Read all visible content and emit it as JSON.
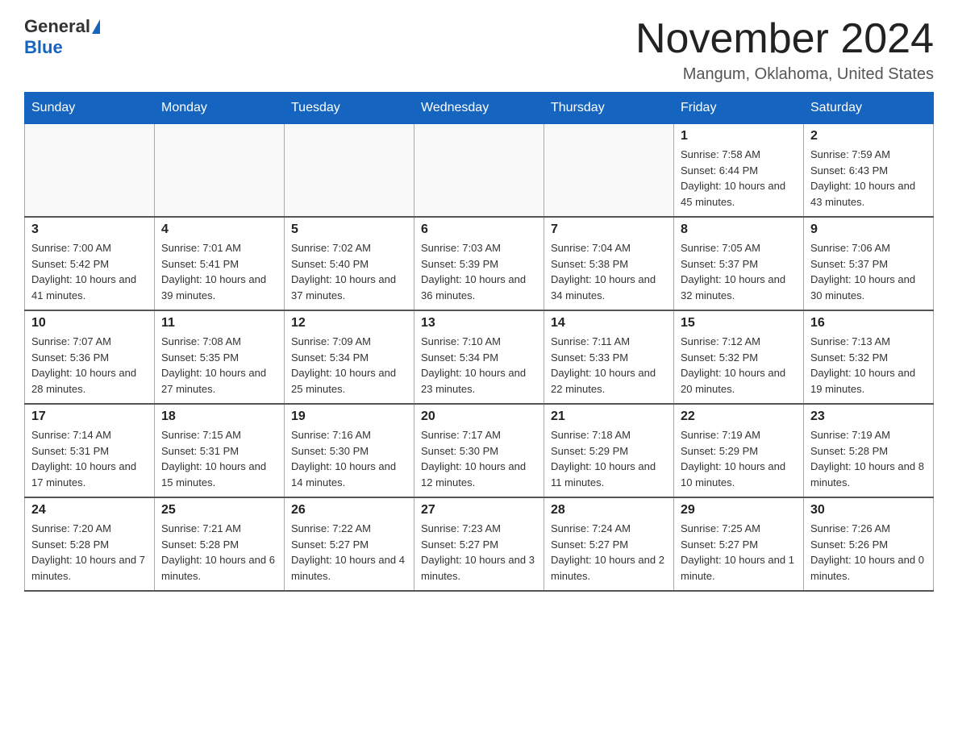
{
  "header": {
    "logo_general": "General",
    "logo_blue": "Blue",
    "month_title": "November 2024",
    "location": "Mangum, Oklahoma, United States"
  },
  "days_of_week": [
    "Sunday",
    "Monday",
    "Tuesday",
    "Wednesday",
    "Thursday",
    "Friday",
    "Saturday"
  ],
  "weeks": [
    [
      {
        "day": "",
        "info": ""
      },
      {
        "day": "",
        "info": ""
      },
      {
        "day": "",
        "info": ""
      },
      {
        "day": "",
        "info": ""
      },
      {
        "day": "",
        "info": ""
      },
      {
        "day": "1",
        "info": "Sunrise: 7:58 AM\nSunset: 6:44 PM\nDaylight: 10 hours and 45 minutes."
      },
      {
        "day": "2",
        "info": "Sunrise: 7:59 AM\nSunset: 6:43 PM\nDaylight: 10 hours and 43 minutes."
      }
    ],
    [
      {
        "day": "3",
        "info": "Sunrise: 7:00 AM\nSunset: 5:42 PM\nDaylight: 10 hours and 41 minutes."
      },
      {
        "day": "4",
        "info": "Sunrise: 7:01 AM\nSunset: 5:41 PM\nDaylight: 10 hours and 39 minutes."
      },
      {
        "day": "5",
        "info": "Sunrise: 7:02 AM\nSunset: 5:40 PM\nDaylight: 10 hours and 37 minutes."
      },
      {
        "day": "6",
        "info": "Sunrise: 7:03 AM\nSunset: 5:39 PM\nDaylight: 10 hours and 36 minutes."
      },
      {
        "day": "7",
        "info": "Sunrise: 7:04 AM\nSunset: 5:38 PM\nDaylight: 10 hours and 34 minutes."
      },
      {
        "day": "8",
        "info": "Sunrise: 7:05 AM\nSunset: 5:37 PM\nDaylight: 10 hours and 32 minutes."
      },
      {
        "day": "9",
        "info": "Sunrise: 7:06 AM\nSunset: 5:37 PM\nDaylight: 10 hours and 30 minutes."
      }
    ],
    [
      {
        "day": "10",
        "info": "Sunrise: 7:07 AM\nSunset: 5:36 PM\nDaylight: 10 hours and 28 minutes."
      },
      {
        "day": "11",
        "info": "Sunrise: 7:08 AM\nSunset: 5:35 PM\nDaylight: 10 hours and 27 minutes."
      },
      {
        "day": "12",
        "info": "Sunrise: 7:09 AM\nSunset: 5:34 PM\nDaylight: 10 hours and 25 minutes."
      },
      {
        "day": "13",
        "info": "Sunrise: 7:10 AM\nSunset: 5:34 PM\nDaylight: 10 hours and 23 minutes."
      },
      {
        "day": "14",
        "info": "Sunrise: 7:11 AM\nSunset: 5:33 PM\nDaylight: 10 hours and 22 minutes."
      },
      {
        "day": "15",
        "info": "Sunrise: 7:12 AM\nSunset: 5:32 PM\nDaylight: 10 hours and 20 minutes."
      },
      {
        "day": "16",
        "info": "Sunrise: 7:13 AM\nSunset: 5:32 PM\nDaylight: 10 hours and 19 minutes."
      }
    ],
    [
      {
        "day": "17",
        "info": "Sunrise: 7:14 AM\nSunset: 5:31 PM\nDaylight: 10 hours and 17 minutes."
      },
      {
        "day": "18",
        "info": "Sunrise: 7:15 AM\nSunset: 5:31 PM\nDaylight: 10 hours and 15 minutes."
      },
      {
        "day": "19",
        "info": "Sunrise: 7:16 AM\nSunset: 5:30 PM\nDaylight: 10 hours and 14 minutes."
      },
      {
        "day": "20",
        "info": "Sunrise: 7:17 AM\nSunset: 5:30 PM\nDaylight: 10 hours and 12 minutes."
      },
      {
        "day": "21",
        "info": "Sunrise: 7:18 AM\nSunset: 5:29 PM\nDaylight: 10 hours and 11 minutes."
      },
      {
        "day": "22",
        "info": "Sunrise: 7:19 AM\nSunset: 5:29 PM\nDaylight: 10 hours and 10 minutes."
      },
      {
        "day": "23",
        "info": "Sunrise: 7:19 AM\nSunset: 5:28 PM\nDaylight: 10 hours and 8 minutes."
      }
    ],
    [
      {
        "day": "24",
        "info": "Sunrise: 7:20 AM\nSunset: 5:28 PM\nDaylight: 10 hours and 7 minutes."
      },
      {
        "day": "25",
        "info": "Sunrise: 7:21 AM\nSunset: 5:28 PM\nDaylight: 10 hours and 6 minutes."
      },
      {
        "day": "26",
        "info": "Sunrise: 7:22 AM\nSunset: 5:27 PM\nDaylight: 10 hours and 4 minutes."
      },
      {
        "day": "27",
        "info": "Sunrise: 7:23 AM\nSunset: 5:27 PM\nDaylight: 10 hours and 3 minutes."
      },
      {
        "day": "28",
        "info": "Sunrise: 7:24 AM\nSunset: 5:27 PM\nDaylight: 10 hours and 2 minutes."
      },
      {
        "day": "29",
        "info": "Sunrise: 7:25 AM\nSunset: 5:27 PM\nDaylight: 10 hours and 1 minute."
      },
      {
        "day": "30",
        "info": "Sunrise: 7:26 AM\nSunset: 5:26 PM\nDaylight: 10 hours and 0 minutes."
      }
    ]
  ]
}
